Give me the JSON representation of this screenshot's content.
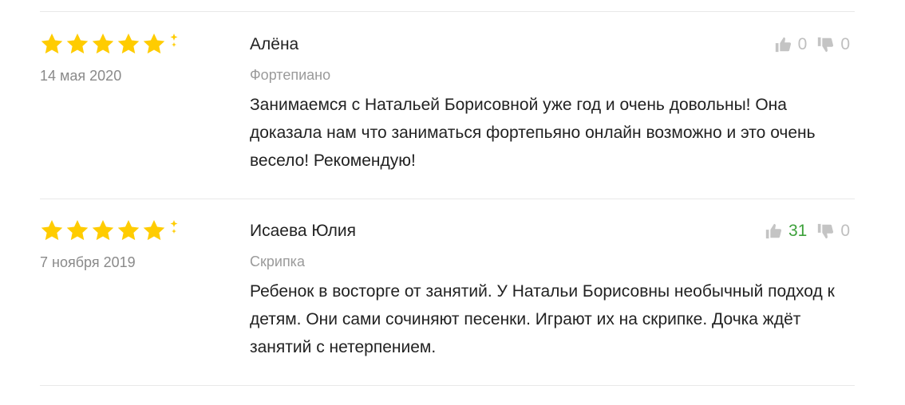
{
  "reviews": [
    {
      "author": "Алёна",
      "date": "14 мая 2020",
      "subject": "Фортепиано",
      "rating": 5,
      "text": "Занимаемся с Натальей Борисовной уже год и очень довольны! Она доказала нам что заниматься фортепьяно онлайн возможно и это очень весело! Рекомендую!",
      "likes": "0",
      "dislikes": "0"
    },
    {
      "author": "Исаева Юлия",
      "date": "7 ноября 2019",
      "subject": "Скрипка",
      "rating": 5,
      "text": "Ребенок в восторге от занятий. У Натальи Борисовны необычный подход к детям. Они сами сочиняют песенки. Играют их на скрипке. Дочка ждёт занятий с нетерпением.",
      "likes": "31",
      "dislikes": "0"
    }
  ],
  "icons": {
    "star": "star-icon",
    "sparkle": "sparkle-icon",
    "like": "thumbs-up-icon",
    "dislike": "thumbs-down-icon"
  },
  "colors": {
    "star": "#FFCC00",
    "positive_count": "#3DA13B",
    "muted": "#BFBFBF",
    "divider": "#E8E8E8"
  }
}
